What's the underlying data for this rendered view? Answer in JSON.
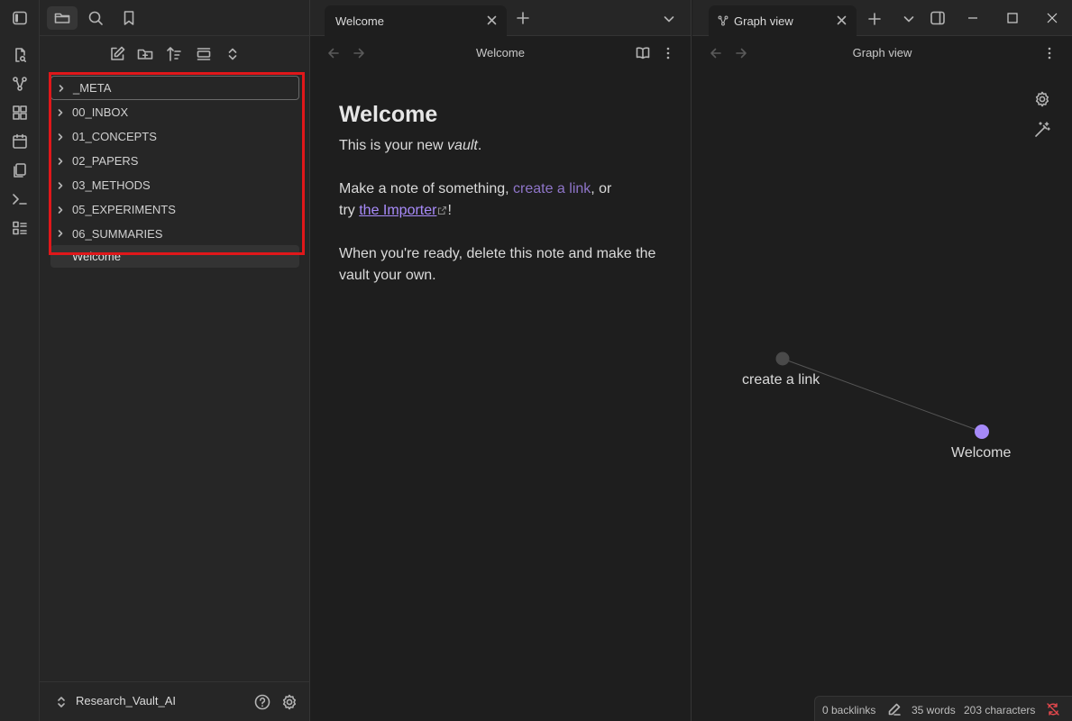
{
  "sidebar": {
    "folders": [
      "_META",
      "00_INBOX",
      "01_CONCEPTS",
      "02_PAPERS",
      "03_METHODS",
      "05_EXPERIMENTS",
      "06_SUMMARIES"
    ],
    "file": "Welcome",
    "vault_name": "Research_Vault_AI"
  },
  "editor": {
    "tab_title": "Welcome",
    "view_title": "Welcome",
    "heading": "Welcome",
    "p1_pre": "This is your new ",
    "p1_em": "vault",
    "p1_post": ".",
    "p2_pre": "Make a note of something, ",
    "p2_link": "create a link",
    "p2_mid": ", or",
    "p2_try": "try ",
    "p2_ext": "the Importer",
    "p2_post": "!",
    "p3": "When you're ready, delete this note and make the vault your own."
  },
  "graph": {
    "tab_title": "Graph view",
    "view_title": "Graph view",
    "nodes": [
      {
        "label": "create a link"
      },
      {
        "label": "Welcome"
      }
    ]
  },
  "status": {
    "backlinks": "0 backlinks",
    "words": "35 words",
    "characters": "203 characters"
  },
  "colors": {
    "accent": "#a88bfa",
    "highlight": "#e0171a"
  }
}
